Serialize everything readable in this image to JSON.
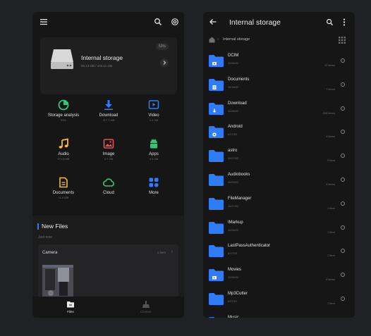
{
  "left": {
    "storage": {
      "title": "Internal storage",
      "sub": "55.13 GB / 104.11 GB",
      "percent": "53%"
    },
    "categories": [
      {
        "label": "Storage analysis",
        "size": "53%",
        "icon": "pie-chart-icon",
        "color": "#35c47a"
      },
      {
        "label": "Download",
        "size": "217.7 MB",
        "icon": "download-icon",
        "color": "#2f7cf6"
      },
      {
        "label": "Video",
        "size": "3.4 GB",
        "icon": "video-icon",
        "color": "#2f7cf6"
      },
      {
        "label": "Audio",
        "size": "971.8 MB",
        "icon": "music-note-icon",
        "color": "#f4b73a"
      },
      {
        "label": "Image",
        "size": "3.7 GB",
        "icon": "image-icon",
        "color": "#e8505b"
      },
      {
        "label": "Apps",
        "size": "4.5 GB",
        "icon": "android-icon",
        "color": "#35c47a"
      },
      {
        "label": "Documents",
        "size": "11.9 MB",
        "icon": "document-icon",
        "color": "#f4b73a"
      },
      {
        "label": "Cloud",
        "size": "",
        "icon": "cloud-icon",
        "color": "#35c47a"
      },
      {
        "label": "More",
        "size": "",
        "icon": "grid-icon",
        "color": "#2f7cf6"
      }
    ],
    "new_files": {
      "title": "New Files",
      "subtitle": "Just now",
      "folder": "Camera",
      "count": "1 item"
    },
    "nav": {
      "files": "Files",
      "cleaner": "Cleaner"
    }
  },
  "right": {
    "title": "Internal storage",
    "breadcrumb": "Internal storage",
    "folders": [
      {
        "name": "DCIM",
        "date": "11/26/22",
        "count": "10 items",
        "badge": "camera"
      },
      {
        "name": "Documents",
        "date": "11/18/22",
        "count": "7 items",
        "badge": "doc"
      },
      {
        "name": "Download",
        "date": "11/26/22",
        "count": "208 items",
        "badge": "download"
      },
      {
        "name": "Android",
        "date": "6/17/22",
        "count": "3 items",
        "badge": "settings"
      },
      {
        "name": "astro",
        "date": "11/27/22",
        "count": "0 item",
        "badge": ""
      },
      {
        "name": "Audiobooks",
        "date": "11/25/22",
        "count": "4 items",
        "badge": ""
      },
      {
        "name": "FileManager",
        "date": "11/17/22",
        "count": "1 item",
        "badge": ""
      },
      {
        "name": "IMarkup",
        "date": "11/26/22",
        "count": "1 item",
        "badge": ""
      },
      {
        "name": "LastPassAuthenticator",
        "date": "6/17/22",
        "count": "1 item",
        "badge": ""
      },
      {
        "name": "Movies",
        "date": "11/26/22",
        "count": "6 items",
        "badge": "movie"
      },
      {
        "name": "Mp3Cutter",
        "date": "6/17/22",
        "count": "1 item",
        "badge": ""
      },
      {
        "name": "Music",
        "date": "",
        "count": "",
        "badge": ""
      }
    ]
  },
  "colors": {
    "accent": "#2f7cf6",
    "folder": "#2f7cf6",
    "bg": "#161617"
  }
}
